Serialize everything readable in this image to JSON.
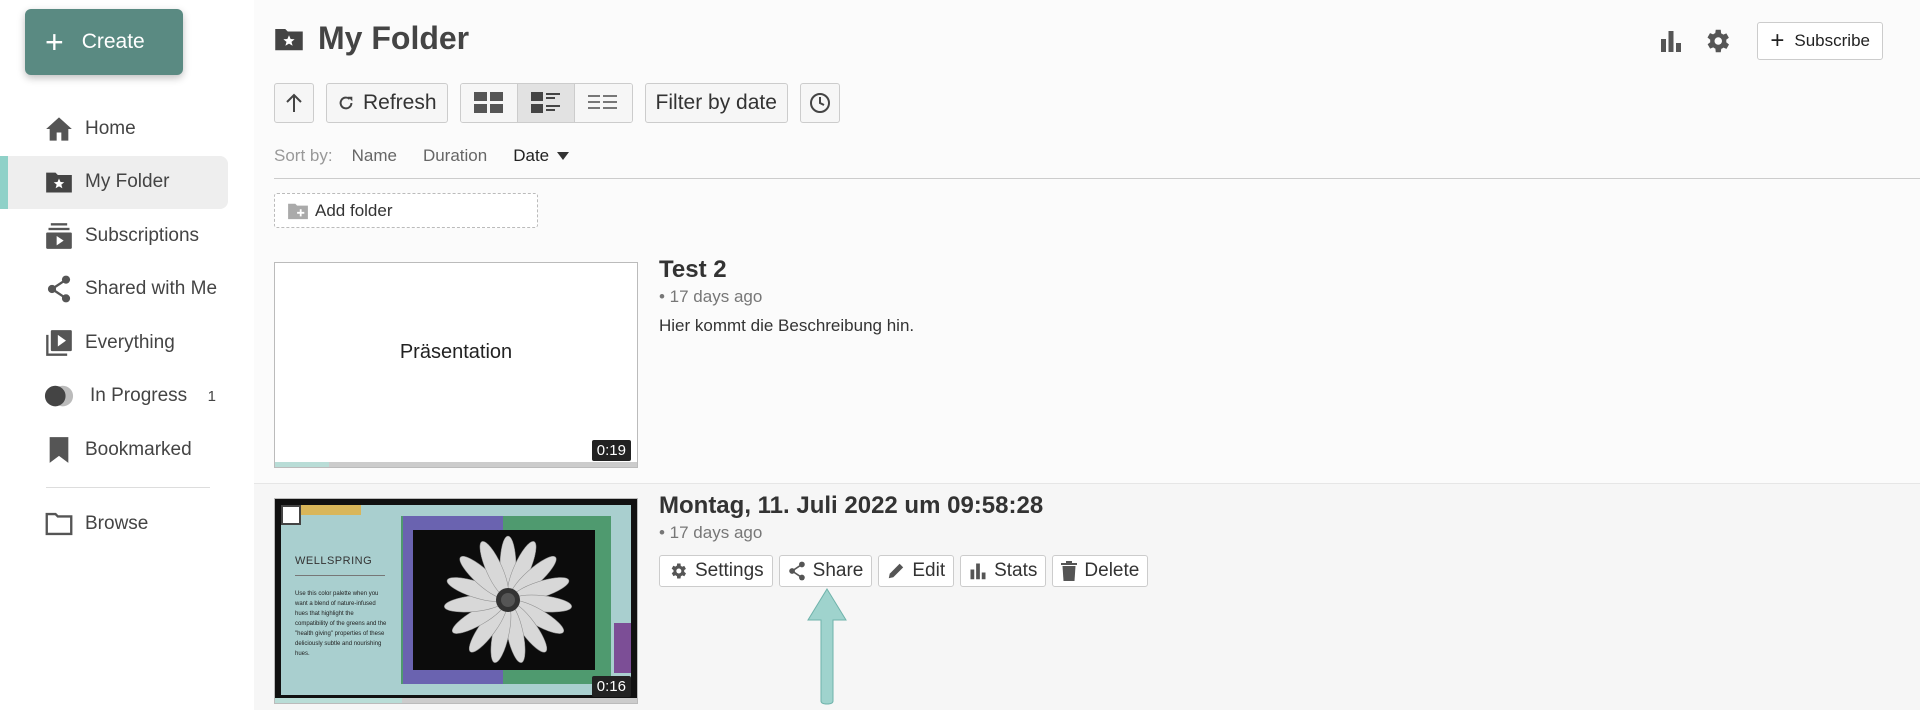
{
  "sidebar": {
    "create_label": "Create",
    "items": [
      {
        "label": "Home",
        "icon": "home-icon"
      },
      {
        "label": "My Folder",
        "icon": "folder-star-icon",
        "active": true
      },
      {
        "label": "Subscriptions",
        "icon": "subscriptions-icon"
      },
      {
        "label": "Shared with Me",
        "icon": "share-icon"
      },
      {
        "label": "Everything",
        "icon": "playlist-icon"
      },
      {
        "label": "In Progress",
        "icon": "in-progress-icon",
        "badge": "1"
      },
      {
        "label": "Bookmarked",
        "icon": "bookmark-icon"
      },
      {
        "label": "Browse",
        "icon": "folder-outline-icon"
      }
    ]
  },
  "header": {
    "title": "My Folder",
    "subscribe_label": "Subscribe"
  },
  "toolbar": {
    "refresh_label": "Refresh",
    "filter_label": "Filter by date",
    "active_view": "detail"
  },
  "sort": {
    "label": "Sort by:",
    "options": [
      "Name",
      "Duration",
      "Date"
    ],
    "active": "Date"
  },
  "add_folder_label": "Add folder",
  "items": [
    {
      "title": "Test 2",
      "age": "• 17 days ago",
      "description": "Hier kommt die Beschreibung hin.",
      "thumb_text": "Präsentation",
      "duration": "0:19",
      "progress": 0.15
    },
    {
      "title": "Montag, 11. Juli 2022 um 09:58:28",
      "age": "• 17 days ago",
      "duration": "0:16",
      "progress": 0.35,
      "slide_heading": "WELLSPRING",
      "slide_body": "Use this color palette when you want a blend of nature-infused hues that highlight the compatibility of the greens and the \"health giving\" properties of these deliciously subtle and nourishing hues.",
      "actions": [
        "Settings",
        "Share",
        "Edit",
        "Stats",
        "Delete"
      ]
    }
  ],
  "colors": {
    "accent": "#5a8a82",
    "active_bar": "#8fd1c8",
    "arrow": "#9fd3cd"
  }
}
